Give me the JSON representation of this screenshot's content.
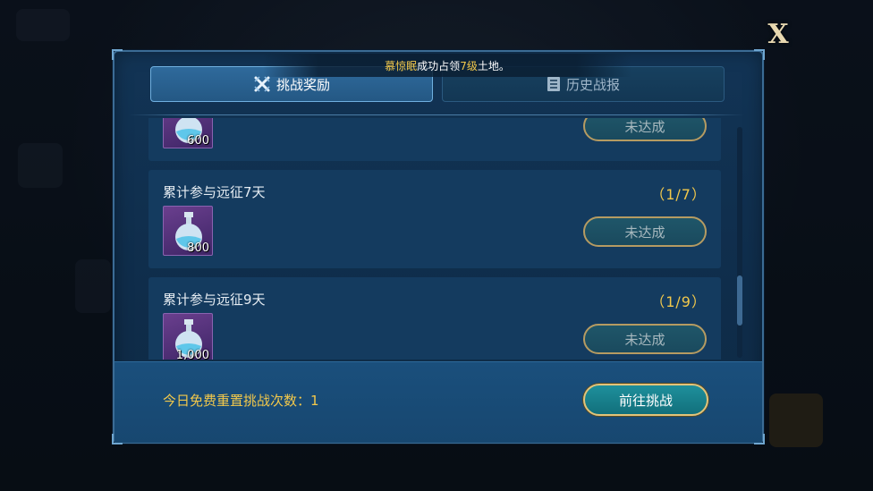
{
  "notice": {
    "name": "慕惊眠",
    "text1": "成功占领",
    "level": "7级",
    "text2": "土地。"
  },
  "tabs": {
    "rewards": "挑战奖励",
    "history": "历史战报"
  },
  "rows": [
    {
      "title": "",
      "progress": "",
      "qty": "600",
      "button": "未达成"
    },
    {
      "title": "累计参与远征7天",
      "progress": "（1/7）",
      "qty": "800",
      "button": "未达成"
    },
    {
      "title": "累计参与远征9天",
      "progress": "（1/9）",
      "qty": "1,000",
      "button": "未达成"
    }
  ],
  "footer": {
    "free_reset_label": "今日免费重置挑战次数：1",
    "go_button": "前往挑战"
  },
  "close": "X",
  "colors": {
    "accent_gold": "#f2c84b",
    "panel_blue": "#123455",
    "button_teal": "#12707c"
  }
}
